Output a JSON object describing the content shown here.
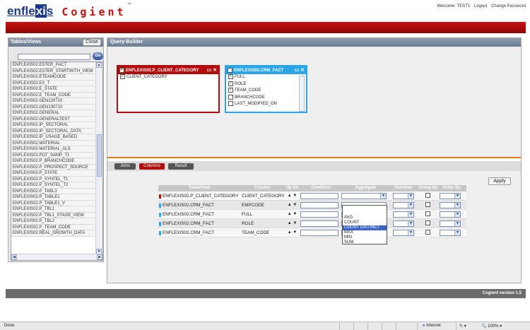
{
  "header": {
    "brand": "enflexis",
    "product": "Cogient",
    "trademark": "™",
    "links": [
      "Welcome: TEST1",
      "Logout",
      "Change Password"
    ]
  },
  "tables_panel": {
    "title": "Tables/Views",
    "close_label": "Close",
    "go_label": "Go",
    "search_value": "",
    "items": [
      "ENFLEXIS02.ESTER_FACT",
      "ENFLEXIS02.ESTER_STARTWITH_VIEW",
      "ENFLEXIS02.ETEAMCODE",
      "ENFLEXIS02.EX_T",
      "ENFLEXIS02.E_STATE",
      "ENFLEXIS02.E_TEAM_CODE",
      "ENFLEXIS02.GEN120710",
      "ENFLEXIS02.GEN130710",
      "ENFLEXIS02.GENERAL",
      "ENFLEXIS02.GENERALTEST",
      "ENFLEXIS02.IP_SECTORAL",
      "ENFLEXIS02.IP_SECTORAL_DATA",
      "ENFLEXIS02.IP_USAGE_BASED",
      "ENFLEXIS02.MATERIAL",
      "ENFLEXIS02.MATERIAL_ALS",
      "ENFLEXIS02.POT_SAMP_T1",
      "ENFLEXIS02.P_BRANCHCODE",
      "ENFLEXIS02.P_PROSPECT_SOURCE",
      "ENFLEXIS02.P_STATE",
      "ENFLEXIS02.P_SYNTEL_T1",
      "ENFLEXIS02.P_SYNTEL_T2",
      "ENFLEXIS02.P_TABL3",
      "ENFLEXIS02.P_TABLE1",
      "ENFLEXIS02.P_TABLE1_V",
      "ENFLEXIS02.P_TBL1",
      "ENFLEXIS02.P_TBL1_STAGE_VIEW",
      "ENFLEXIS02.P_TBL2",
      "ENFLEXIS02.P_TEAM_CODE",
      "ENFLEXIS02.REAL_GROWTH_DATA"
    ]
  },
  "query_builder": {
    "title": "Query Builder",
    "table1": {
      "name": "ENFLEXIS02.P_CLIENT_CATEGORY",
      "controls": "▭ ✕",
      "checked": true,
      "columns": [
        {
          "name": "CLIENT_CATEGORY",
          "checked": true
        }
      ]
    },
    "table2": {
      "name": "ENFLEXIS02.CRM_FACT",
      "controls": "▭ ✕",
      "checked": false,
      "columns": [
        {
          "name": "FULL",
          "checked": true
        },
        {
          "name": "ROLE",
          "checked": true
        },
        {
          "name": "TEAM_CODE",
          "checked": true
        },
        {
          "name": "BRANCHCODE",
          "checked": false
        },
        {
          "name": "LAST_MODIFIED_ON",
          "checked": false
        }
      ]
    },
    "tabs": [
      "Joins",
      "Columns",
      "Result"
    ],
    "active_tab": "Columns",
    "apply_label": "Apply",
    "column_headers": [
      "Table/View",
      "Column",
      "Up Dn",
      "Condition",
      "Aggregate",
      "Function",
      "Group By",
      "Order By"
    ],
    "rows": [
      {
        "table": "ENFLEXIS02.P_CLIENT_CATEGORY",
        "column": "CLIENT_CATEGORY",
        "marker": "#b20b0b"
      },
      {
        "table": "ENFLEXIS02.CRM_FACT",
        "column": "EMPCODE",
        "marker": "#2aa6e8"
      },
      {
        "table": "ENFLEXIS02.CRM_FACT",
        "column": "FULL",
        "marker": "#2aa6e8"
      },
      {
        "table": "ENFLEXIS02.CRM_FACT",
        "column": "ROLE",
        "marker": "#2aa6e8"
      },
      {
        "table": "ENFLEXIS02.CRM_FACT",
        "column": "TEAM_CODE",
        "marker": "#2aa6e8"
      }
    ],
    "up_dn": "▲ ▼",
    "aggregate_options": [
      "AVG",
      "COUNT",
      "COUNT DISTINCT",
      "MAX",
      "MIN",
      "SUM"
    ],
    "aggregate_highlighted": "COUNT DISTINCT"
  },
  "footer": {
    "version": "Cogient version 1.5"
  },
  "statusbar": {
    "status": "Done",
    "zone": "Internet",
    "zoom": "100%"
  },
  "colors": {
    "brand_red": "#b20b0b",
    "accent_blue": "#2aa6e8",
    "divider_orange": "#e67a22"
  }
}
